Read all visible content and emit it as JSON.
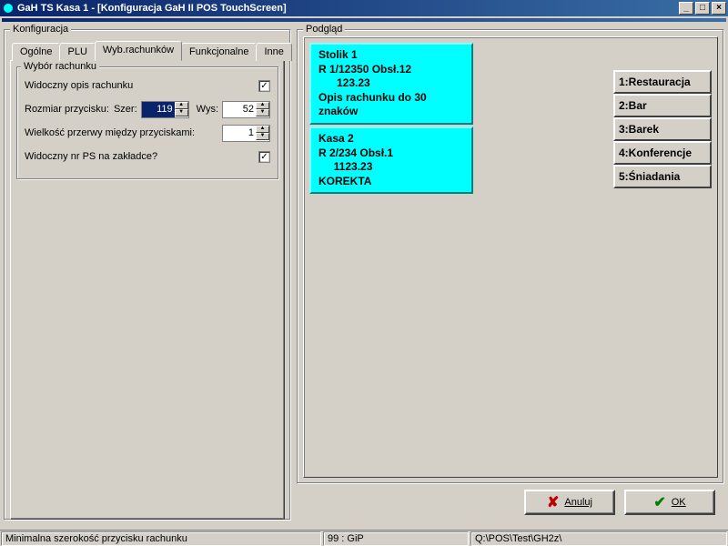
{
  "window": {
    "title": "GaH TS  Kasa 1 - [Konfiguracja GaH II POS TouchScreen]"
  },
  "config_panel": {
    "title": "Konfiguracja",
    "tabs": {
      "0": "Ogólne",
      "1": "PLU",
      "2": "Wyb.rachunków",
      "3": "Funkcjonalne",
      "4": "Inne"
    },
    "group": {
      "title": "Wybór rachunku",
      "visible_desc_label": "Widoczny opis rachunku",
      "visible_desc_checked": "✓",
      "size_label": "Rozmiar przycisku:",
      "szer_label": "Szer:",
      "szer_value": "119",
      "wys_label": "Wys:",
      "wys_value": "52",
      "gap_label": "Wielkość przerwy między przyciskami:",
      "gap_value": "1",
      "ps_tab_label": "Widoczny nr PS na zakładce?",
      "ps_tab_checked": "✓"
    }
  },
  "preview_panel": {
    "title": "Podgląd",
    "tiles": [
      {
        "t1": "Stolik 1",
        "t2": "R 1/12350 Obsł.12",
        "t3": "      123.23",
        "t4": "Opis rachunku do 30 znaków"
      },
      {
        "t1": "Kasa 2",
        "t2": "R 2/234 Obsł.1",
        "t3": "     1123.23",
        "t4": "KOREKTA"
      }
    ],
    "side": {
      "0": "1:Restauracja",
      "1": "2:Bar",
      "2": "3:Barek",
      "3": "4:Konferencje",
      "4": "5:Śniadania"
    }
  },
  "buttons": {
    "cancel": "Anuluj",
    "ok": "OK"
  },
  "status": {
    "hint": "Minimalna szerokość przycisku rachunku",
    "user": "99 : GiP",
    "path": "Q:\\POS\\Test\\GH2z\\"
  }
}
